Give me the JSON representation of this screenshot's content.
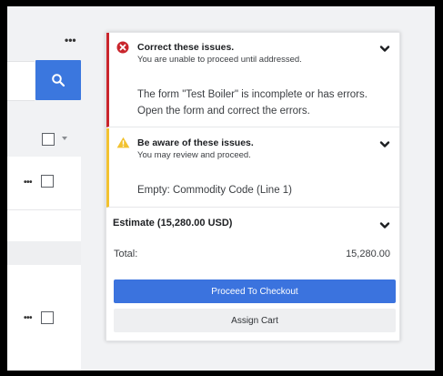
{
  "left_list": {
    "more_dots": "•••",
    "row_dots": "•••"
  },
  "alerts": {
    "error": {
      "title": "Correct these issues.",
      "subtitle": "You are unable to proceed until addressed.",
      "message_line1": "The form \"Test Boiler\" is incomplete or has errors.",
      "message_line2": "Open the form and correct the errors.",
      "color": "#c9252c",
      "icon": "error-x-circle-icon"
    },
    "warning": {
      "title": "Be aware of these issues.",
      "subtitle": "You may review and proceed.",
      "message": "Empty: Commodity Code (Line 1)",
      "color": "#f2c230",
      "icon": "warning-triangle-icon"
    }
  },
  "estimate": {
    "title": "Estimate (15,280.00 USD)",
    "total_label": "Total:",
    "total_value": "15,280.00"
  },
  "buttons": {
    "proceed_label": "Proceed To Checkout",
    "assign_label": "Assign Cart"
  },
  "colors": {
    "accent": "#3b73de",
    "search_button": "#3b77de"
  }
}
